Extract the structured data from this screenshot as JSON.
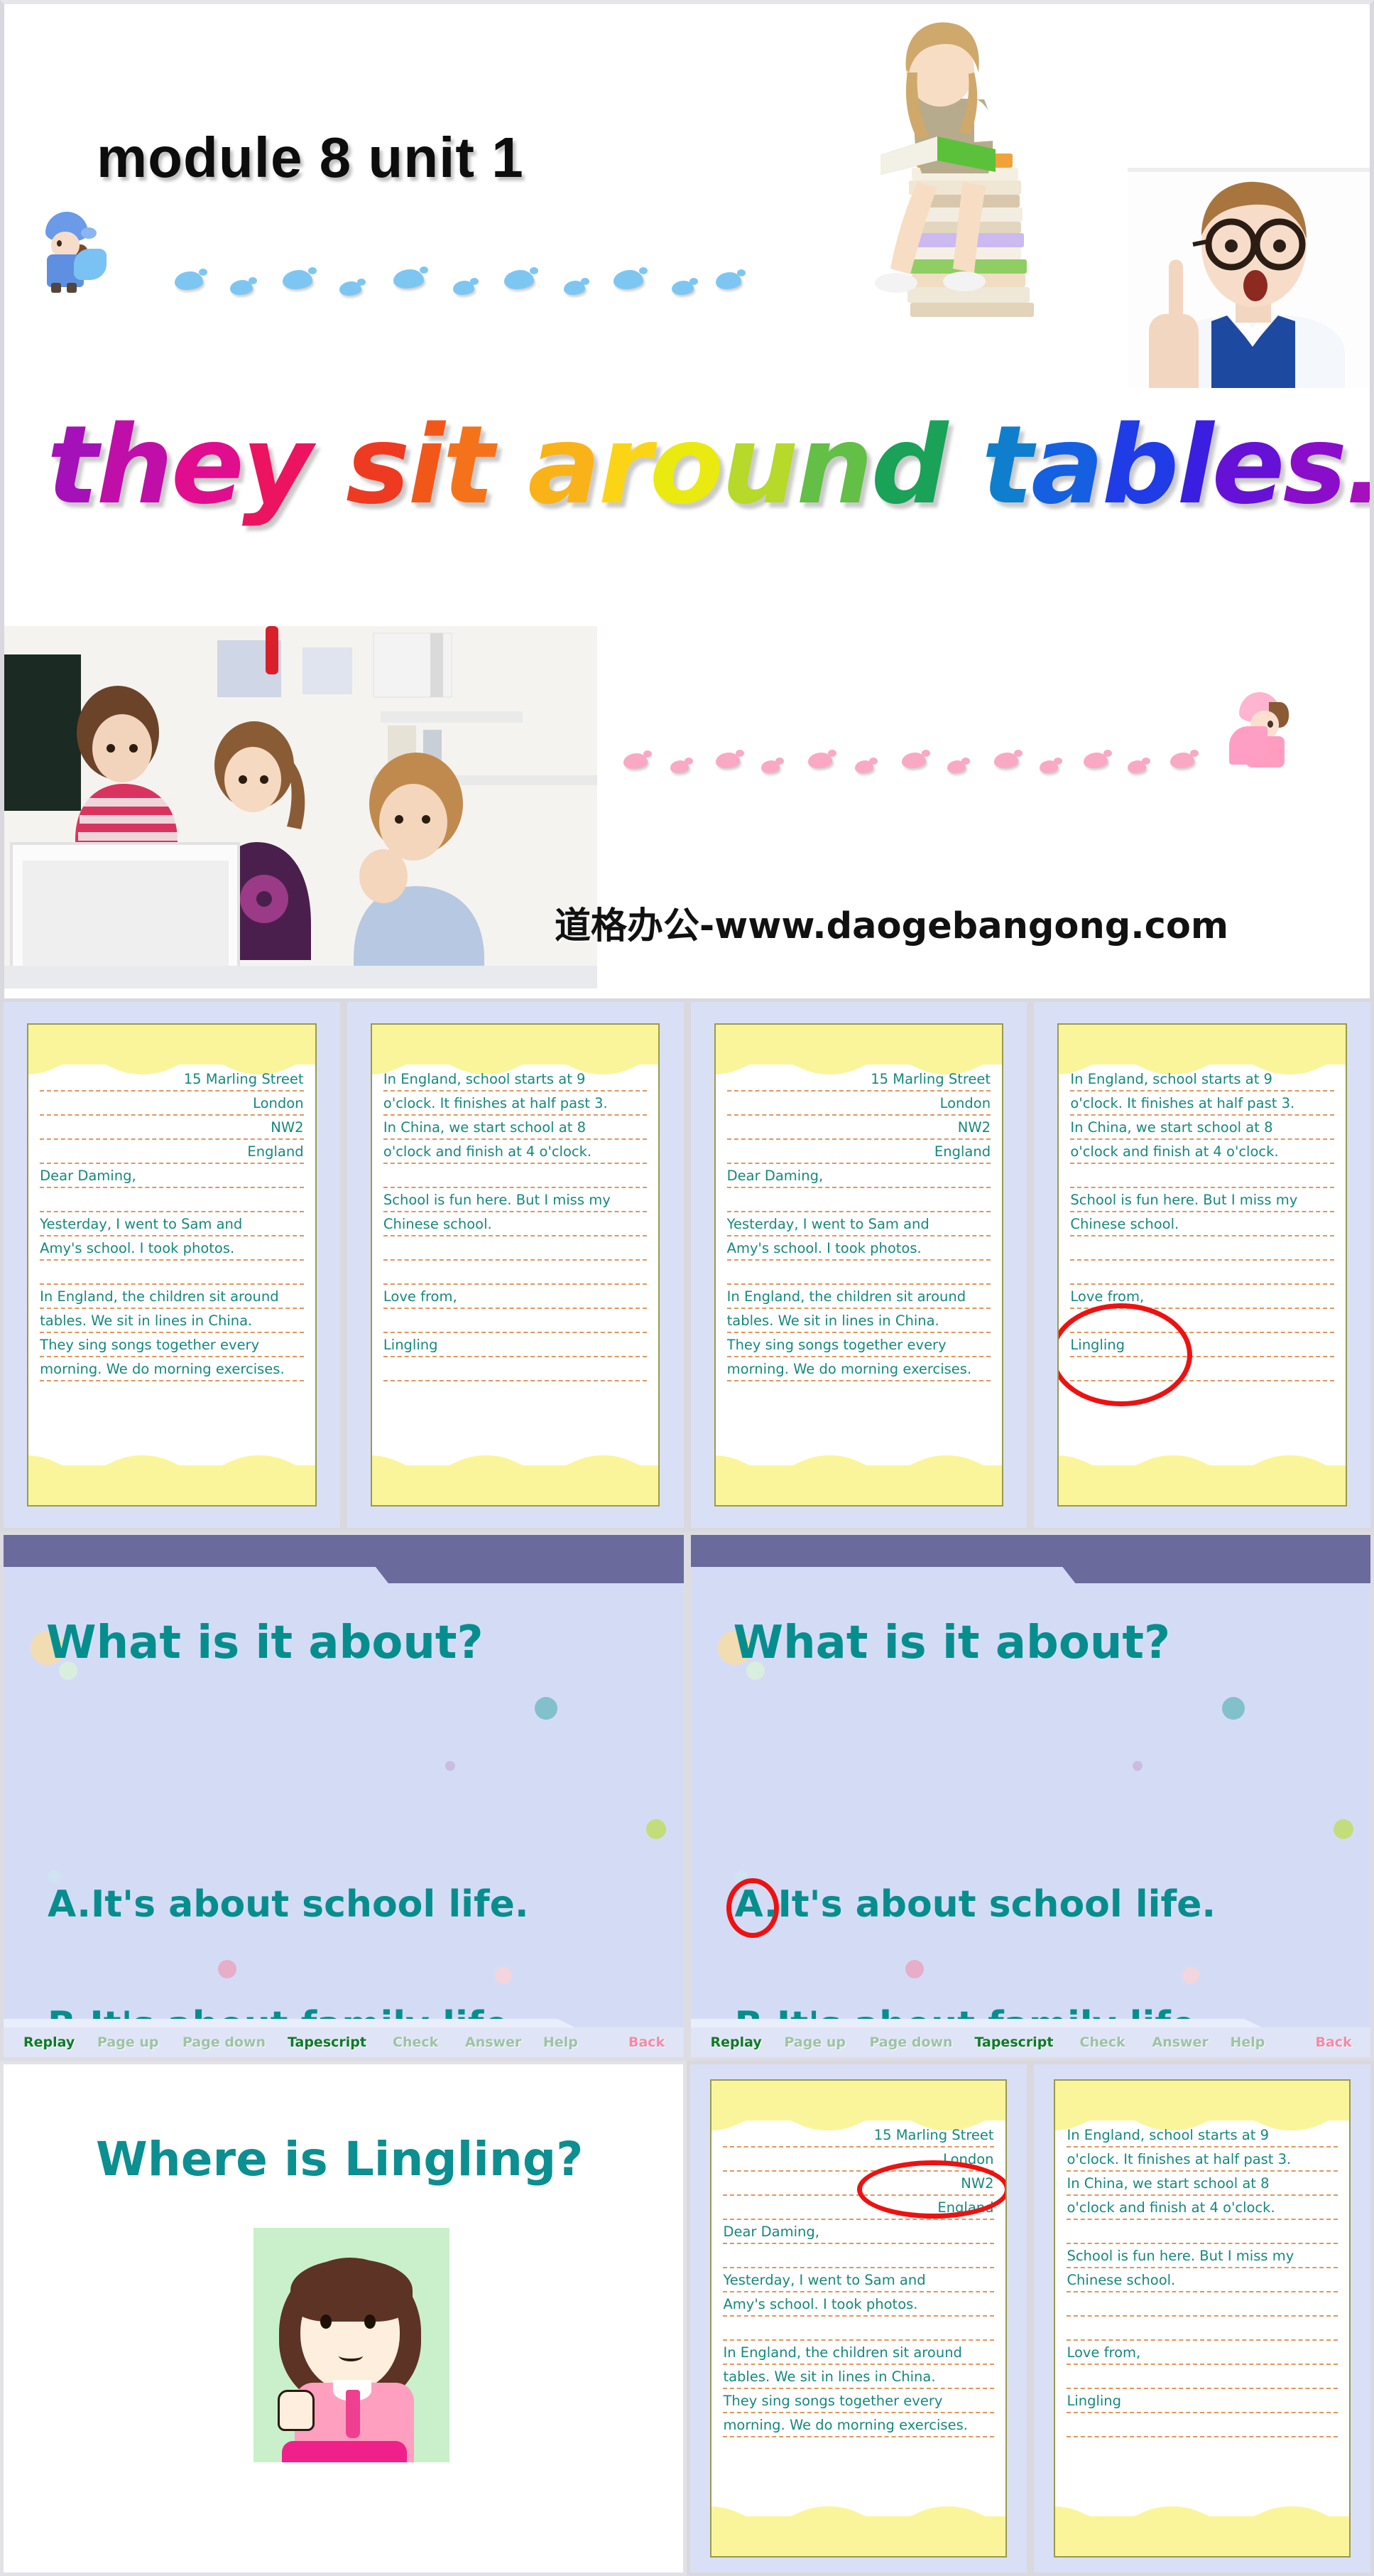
{
  "slide_title": {
    "module_heading": "module 8 unit 1",
    "wordart": [
      {
        "ch": "t",
        "color": "#a511b8"
      },
      {
        "ch": "h",
        "color": "#c00fa8"
      },
      {
        "ch": "e",
        "color": "#e00d8e"
      },
      {
        "ch": "y",
        "color": "#ec1361"
      },
      {
        "ch": " ",
        "color": "#ffffff"
      },
      {
        "ch": "s",
        "color": "#ef3a22"
      },
      {
        "ch": "i",
        "color": "#f2571a"
      },
      {
        "ch": "t",
        "color": "#f4731a"
      },
      {
        "ch": " ",
        "color": "#ffffff"
      },
      {
        "ch": "a",
        "color": "#f9b318"
      },
      {
        "ch": "r",
        "color": "#fbd515"
      },
      {
        "ch": "o",
        "color": "#eaea10"
      },
      {
        "ch": "u",
        "color": "#b6d92a"
      },
      {
        "ch": "n",
        "color": "#63bf45"
      },
      {
        "ch": "d",
        "color": "#19a258"
      },
      {
        "ch": " ",
        "color": "#ffffff"
      },
      {
        "ch": "t",
        "color": "#0f7fcd"
      },
      {
        "ch": "a",
        "color": "#1560e0"
      },
      {
        "ch": "b",
        "color": "#1f3ce6"
      },
      {
        "ch": "l",
        "color": "#3a1fe0"
      },
      {
        "ch": "e",
        "color": "#6611d6"
      },
      {
        "ch": "s",
        "color": "#8a0ec9"
      },
      {
        "ch": ".",
        "color": "#a510bd"
      }
    ],
    "watermark": "道格办公-www.daogebangong.com",
    "photo_girl_books": "girl-sitting-on-books-photo",
    "photo_boy_glasses": "surprised-boy-with-glasses-photo",
    "photo_classroom": "children-at-computer-photo",
    "blue_footprints": 12,
    "pink_footprints": 14
  },
  "letter": {
    "page_one": [
      {
        "text": "15 Marling Street",
        "align": "right"
      },
      {
        "text": "London",
        "align": "right"
      },
      {
        "text": "NW2",
        "align": "right"
      },
      {
        "text": "England",
        "align": "right"
      },
      {
        "text": "Dear Daming,",
        "align": "left"
      },
      {
        "text": "",
        "align": "left"
      },
      {
        "text": "Yesterday, I went to Sam and",
        "align": "left"
      },
      {
        "text": "Amy's school. I took photos.",
        "align": "left"
      },
      {
        "text": "",
        "align": "left"
      },
      {
        "text": "In England, the children sit around",
        "align": "left"
      },
      {
        "text": "tables. We sit in lines in China.",
        "align": "left"
      },
      {
        "text": "They sing songs together every",
        "align": "left"
      },
      {
        "text": "morning. We do morning exercises.",
        "align": "left"
      }
    ],
    "page_two": [
      {
        "text": "In England, school starts at 9",
        "align": "left"
      },
      {
        "text": "o'clock. It finishes at half past 3.",
        "align": "left"
      },
      {
        "text": "In China, we start school at 8",
        "align": "left"
      },
      {
        "text": "o'clock and finish at 4 o'clock.",
        "align": "left"
      },
      {
        "text": "",
        "align": "left"
      },
      {
        "text": "School is fun here. But I miss my",
        "align": "left"
      },
      {
        "text": "Chinese school.",
        "align": "left"
      },
      {
        "text": "",
        "align": "left"
      },
      {
        "text": "",
        "align": "left"
      },
      {
        "text": "Love from,",
        "align": "left"
      },
      {
        "text": "",
        "align": "left"
      },
      {
        "text": "Lingling",
        "align": "left"
      },
      {
        "text": "",
        "align": "left"
      }
    ],
    "highlight_color": "#ee1111"
  },
  "question": {
    "title": "What is it about?",
    "option_a": "A.It's about school life.",
    "option_b": "B.It's about family life.",
    "answer_marked": "A",
    "accent_color": "#068e8e",
    "band_color": "#6a6a9c",
    "toolbar": [
      {
        "label": "Replay",
        "color": "#0f7a28",
        "state": "active"
      },
      {
        "label": "Page up",
        "color": "#9dc3a4",
        "state": "disabled"
      },
      {
        "label": "Page down",
        "color": "#9dc3a4",
        "state": "disabled"
      },
      {
        "label": "Tapescript",
        "color": "#0f7a28",
        "state": "active"
      },
      {
        "label": "Check",
        "color": "#9dc3a4",
        "state": "disabled"
      },
      {
        "label": "Answer",
        "color": "#9dc3a4",
        "state": "disabled"
      },
      {
        "label": "Help",
        "color": "#9dc3a4",
        "state": "disabled"
      },
      {
        "label": "Back",
        "color": "#f48aa6",
        "state": "active"
      }
    ]
  },
  "lingling": {
    "title": "Where is Lingling?",
    "image_alt": "lingling-cartoon-girl-waving",
    "image_bg": "#c9f0cb"
  }
}
